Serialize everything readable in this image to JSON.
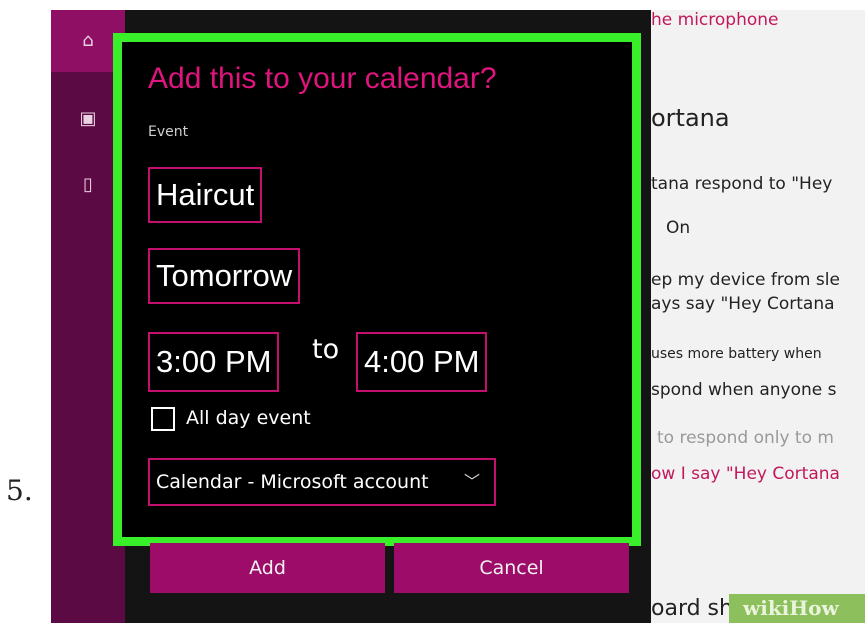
{
  "step_number": "5.",
  "nav": {
    "items": [
      {
        "icon": "home-icon",
        "glyph": "⌂"
      },
      {
        "icon": "notebook-icon",
        "glyph": "▣"
      },
      {
        "icon": "device-icon",
        "glyph": "▯"
      }
    ]
  },
  "dialog": {
    "title": "Add this to your calendar?",
    "event_label": "Event",
    "event_name": "Haircut",
    "date": "Tomorrow",
    "start_time": "3:00 PM",
    "to_label": "to",
    "end_time": "4:00 PM",
    "all_day_label": "All day event",
    "calendar_select": "Calendar - Microsoft account",
    "add_button": "Add",
    "cancel_button": "Cancel",
    "accent_color": "#e0147f",
    "highlight_color": "#39ef2a"
  },
  "settings_fragments": {
    "mic_link": "he microphone",
    "heading": "ortana",
    "line1": "tana respond to \"Hey",
    "toggle_state": "On",
    "line2": "ep my device from sle",
    "line3": "ays say \"Hey Cortana",
    "line4": "uses more battery when",
    "line5": "spond when anyone s",
    "line6": "to respond only to m",
    "line7": "ow I say \"Hey Cortana",
    "line8": "oard sh"
  },
  "watermark": "wikiHow"
}
